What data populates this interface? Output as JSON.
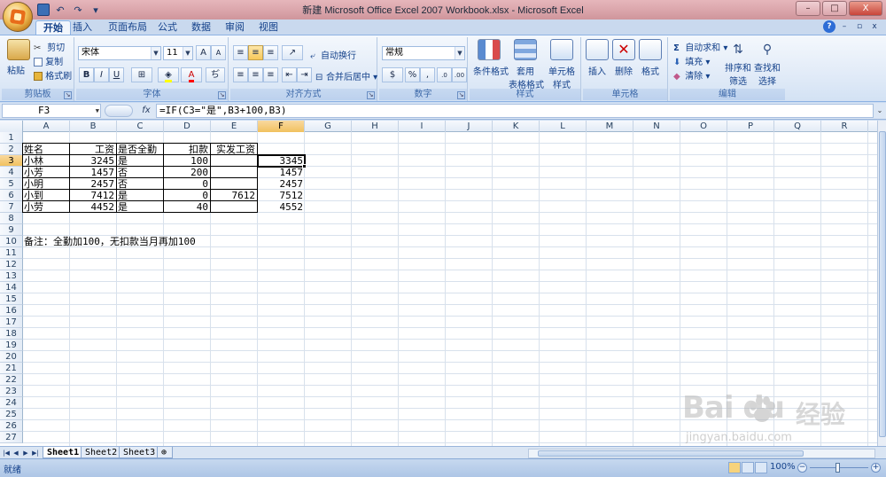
{
  "window": {
    "title": "新建 Microsoft Office Excel 2007 Workbook.xlsx - Microsoft Excel",
    "controls": [
      "–",
      "□",
      "X"
    ]
  },
  "qat": {
    "undo": "↶",
    "redo": "↷",
    "customize": "▾"
  },
  "tabs": [
    "开始",
    "插入",
    "页面布局",
    "公式",
    "数据",
    "审阅",
    "视图"
  ],
  "active_tab": "开始",
  "ribbon": {
    "clipboard": {
      "label": "剪贴板",
      "paste": "粘贴",
      "cut": "剪切",
      "copy": "复制",
      "format_painter": "格式刷"
    },
    "font": {
      "label": "字体",
      "font_name": "宋体",
      "font_size": "11",
      "bold": "B",
      "italic": "I",
      "underline": "U",
      "grow": "A",
      "shrink": "A"
    },
    "alignment": {
      "label": "对齐方式",
      "wrap": "自动换行",
      "merge": "合并后居中"
    },
    "number": {
      "label": "数字",
      "format": "常规",
      "percent": "%",
      "comma": ","
    },
    "styles": {
      "label": "样式",
      "conditional": "条件格式",
      "table_top": "套用",
      "table_bottom": "表格格式",
      "cell_top": "单元格",
      "cell_bottom": "样式"
    },
    "cells": {
      "label": "单元格",
      "insert": "插入",
      "delete": "删除",
      "format": "格式"
    },
    "editing": {
      "label": "编辑",
      "autosum": "自动求和",
      "fill": "填充",
      "clear": "清除",
      "sort_top": "排序和",
      "sort_bottom": "筛选",
      "find_top": "查找和",
      "find_bottom": "选择"
    }
  },
  "formula_bar": {
    "name_box": "F3",
    "fx": "fx",
    "formula": "=IF(C3=\"是\",B3+100,B3)"
  },
  "columns": [
    "A",
    "B",
    "C",
    "D",
    "E",
    "F",
    "G",
    "H",
    "I",
    "J",
    "K",
    "L",
    "M",
    "N",
    "O",
    "P",
    "Q",
    "R"
  ],
  "rows": [
    "1",
    "2",
    "3",
    "4",
    "5",
    "6",
    "7",
    "8",
    "9",
    "10",
    "11",
    "12",
    "13",
    "14",
    "15",
    "16",
    "17",
    "18",
    "19",
    "20",
    "21",
    "22",
    "23",
    "24",
    "25",
    "26",
    "27"
  ],
  "sheet": {
    "headers": {
      "A": "姓名",
      "B": "工资",
      "C": "是否全勤",
      "D": "扣款",
      "E": "实发工资"
    },
    "data": [
      {
        "A": "小林",
        "B": "3245",
        "C": "是",
        "D": "100",
        "E": "",
        "F": "3345"
      },
      {
        "A": "小芳",
        "B": "1457",
        "C": "否",
        "D": "200",
        "E": "",
        "F": "1457"
      },
      {
        "A": "小明",
        "B": "2457",
        "C": "否",
        "D": "0",
        "E": "",
        "F": "2457"
      },
      {
        "A": "小到",
        "B": "7412",
        "C": "是",
        "D": "0",
        "E": "7612",
        "F": "7512"
      },
      {
        "A": "小劳",
        "B": "4452",
        "C": "是",
        "D": "40",
        "E": "",
        "F": "4552"
      }
    ],
    "note": "备注：全勤加100，无扣款当月再加100"
  },
  "sheet_tabs": [
    "Sheet1",
    "Sheet2",
    "Sheet3"
  ],
  "active_sheet": "Sheet1",
  "status": {
    "text": "就绪",
    "zoom": "100%"
  },
  "watermark": {
    "logo": "Bai du",
    "jingyan": "经验",
    "url": "jingyan.baidu.com"
  },
  "colors": {
    "title_bar": "#d9a3a9",
    "ribbon": "#e3ecf8",
    "selection": "#f1c15f"
  }
}
